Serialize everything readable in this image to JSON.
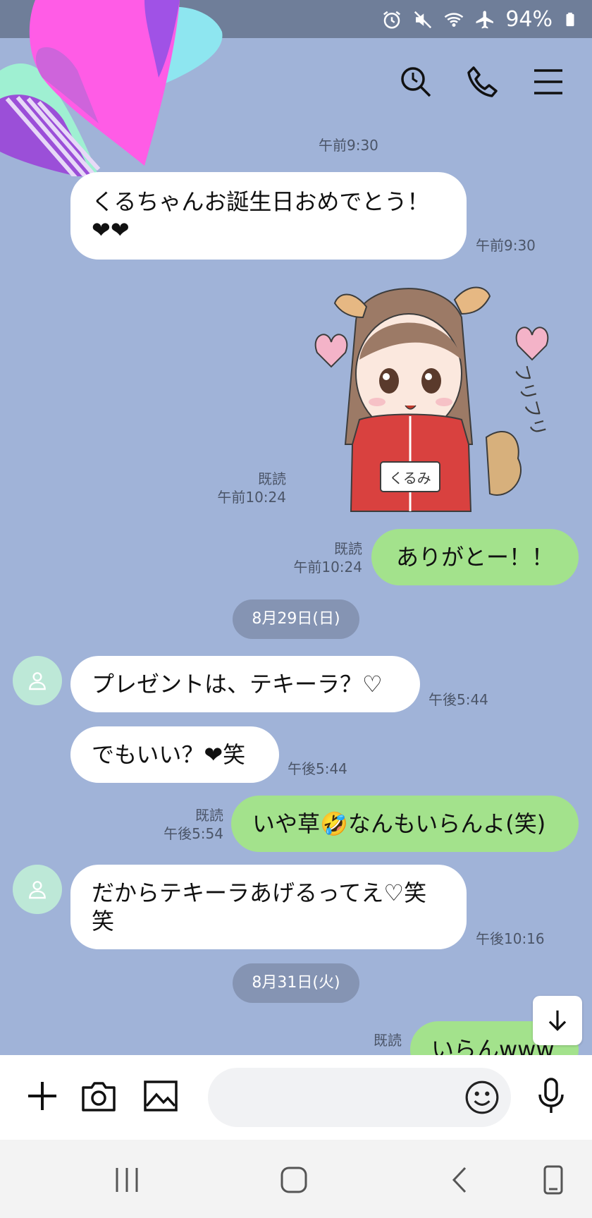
{
  "status": {
    "battery": "94%"
  },
  "colors": {
    "background": "#a0b3d8",
    "mine": "#a3e28c",
    "theirs": "#ffffff",
    "pill": "#8594b3"
  },
  "messages": [
    {
      "text": "くるちゃんお誕生日おめでとう！\n❤❤",
      "time": "午前9:30"
    },
    {
      "read": "既読",
      "time": "午前10:24"
    },
    {
      "text": "ありがとー！！",
      "read": "既読",
      "time": "午前10:24"
    },
    {
      "text": "プレゼントは、テキーラ？♡",
      "time": "午後5:44"
    },
    {
      "text": "でもいい？❤笑",
      "time": "午後5:44"
    },
    {
      "text": "いや草🤣なんもいらんよ(笑)",
      "read": "既読",
      "time": "午後5:54"
    },
    {
      "text": "だからテキーラあげるってえ♡笑\n笑",
      "time": "午後10:16"
    },
    {
      "text": "いらんwww",
      "read": "既読"
    }
  ],
  "top_time": "午前9:30",
  "dates": [
    "8月29日(日)",
    "8月31日(火)"
  ],
  "sticker": {
    "name_tag": "くるみ",
    "sfx": "フリフリ"
  }
}
